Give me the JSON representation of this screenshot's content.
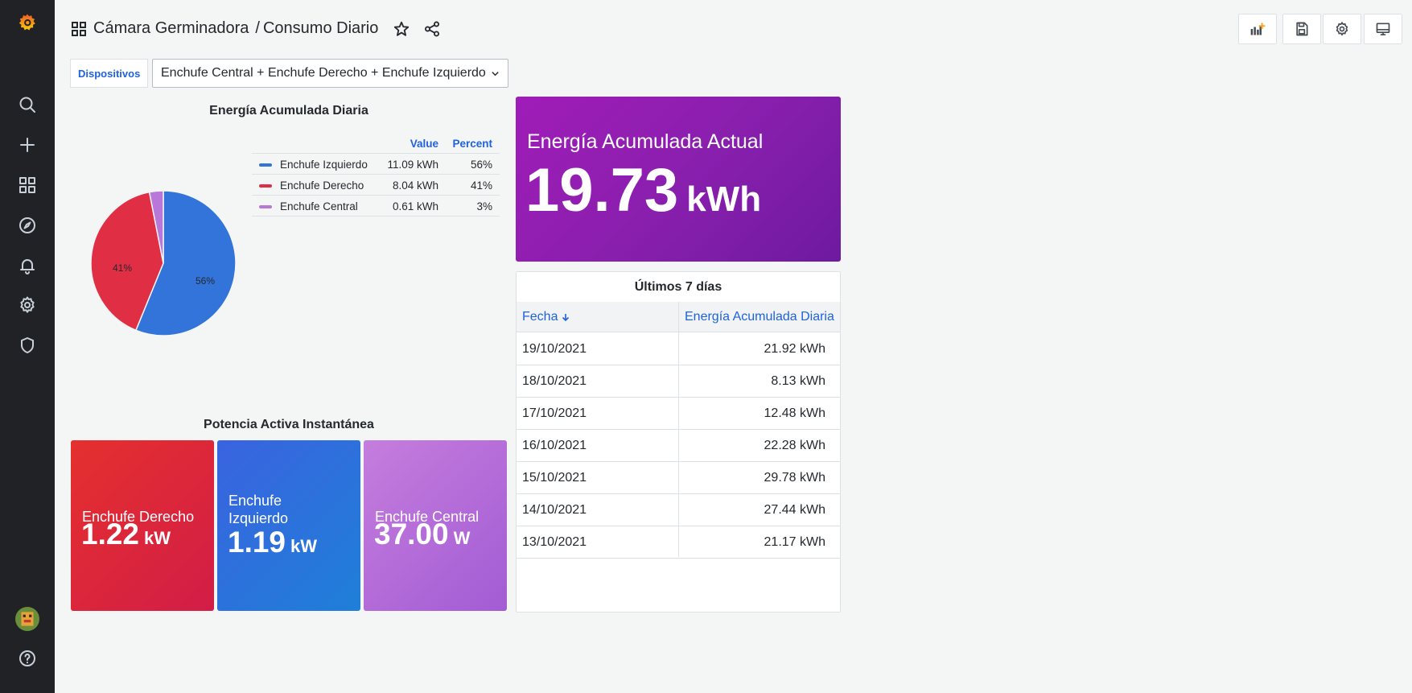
{
  "breadcrumb": {
    "folder": "Cámara Germinadora",
    "separator": "/",
    "dashboard": "Consumo Diario"
  },
  "variable": {
    "label": "Dispositivos",
    "value": "Enchufe Central + Enchufe Derecho + Enchufe Izquierdo"
  },
  "pie_panel": {
    "title": "Energía Acumulada Diaria",
    "legend_headers": {
      "value": "Value",
      "percent": "Percent"
    },
    "legend": [
      {
        "name": "Enchufe Izquierdo",
        "value": "11.09 kWh",
        "percent": "56%",
        "color": "#3274d9"
      },
      {
        "name": "Enchufe Derecho",
        "value": "8.04 kWh",
        "percent": "41%",
        "color": "#e02f44"
      },
      {
        "name": "Enchufe Central",
        "value": "0.61 kWh",
        "percent": "3%",
        "color": "#b877d9"
      }
    ],
    "slice_labels": {
      "izquierdo": "56%",
      "derecho": "41%"
    }
  },
  "chart_data": {
    "type": "pie",
    "title": "Energía Acumulada Diaria",
    "categories": [
      "Enchufe Izquierdo",
      "Enchufe Derecho",
      "Enchufe Central"
    ],
    "values": [
      11.09,
      8.04,
      0.61
    ],
    "unit": "kWh",
    "percents": [
      56,
      41,
      3
    ],
    "colors": [
      "#3274d9",
      "#e02f44",
      "#b877d9"
    ],
    "legend_placement": "right"
  },
  "stat_panel": {
    "title": "Energía Acumulada Actual",
    "value": "19.73",
    "unit": "kWh"
  },
  "table_panel": {
    "title": "Últimos 7 días",
    "headers": {
      "date": "Fecha",
      "energy": "Energía Acumulada Diaria"
    },
    "sort_icon": "arrow-down-icon",
    "rows": [
      {
        "date": "19/10/2021",
        "value": "21.92 kWh"
      },
      {
        "date": "18/10/2021",
        "value": "8.13 kWh"
      },
      {
        "date": "17/10/2021",
        "value": "12.48 kWh"
      },
      {
        "date": "16/10/2021",
        "value": "22.28 kWh"
      },
      {
        "date": "15/10/2021",
        "value": "29.78 kWh"
      },
      {
        "date": "14/10/2021",
        "value": "27.44 kWh"
      },
      {
        "date": "13/10/2021",
        "value": "21.17 kWh"
      }
    ]
  },
  "power_panel": {
    "title": "Potencia Activa Instantánea",
    "tiles": [
      {
        "name": "Enchufe Derecho",
        "value": "1.22",
        "unit": "kW"
      },
      {
        "name": "Enchufe Izquierdo",
        "value": "1.19",
        "unit": "kW"
      },
      {
        "name": "Enchufe Central",
        "value": "37.00",
        "unit": "W"
      }
    ]
  },
  "colors": {
    "accent": "#1f62e0",
    "sidebar": "#202226",
    "purple": "#8f1fb0"
  }
}
